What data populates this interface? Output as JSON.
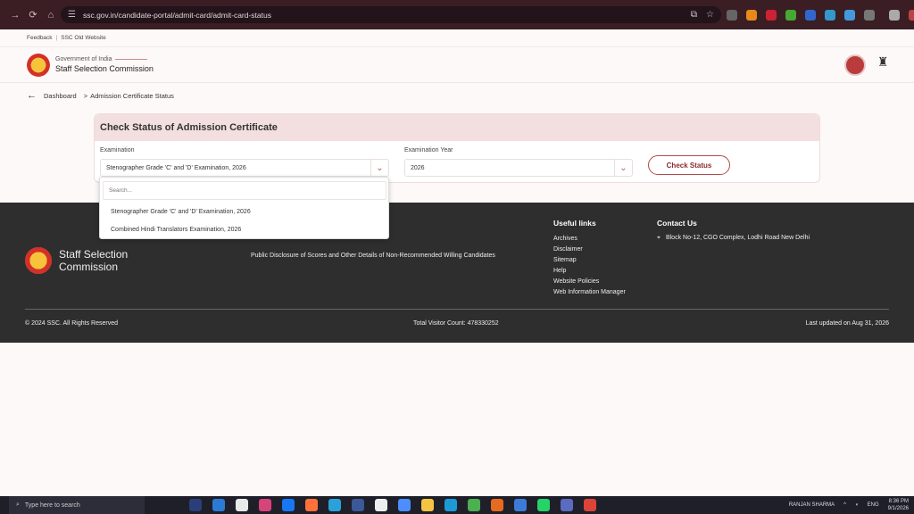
{
  "browser": {
    "url": "ssc.gov.in/candidate-portal/admit-card/admit-card-status"
  },
  "topbar": {
    "feedback": "Feedback",
    "old_site": "SSC Old Website"
  },
  "header": {
    "gov": "Government of India",
    "org": "Staff Selection Commission"
  },
  "breadcrumb": {
    "dashboard": "Dashboard",
    "separator": ">",
    "current": "Admission Certificate Status"
  },
  "form": {
    "title": "Check Status of Admission Certificate",
    "exam_label": "Examination",
    "exam_value": "Stenographer Grade 'C' and 'D' Examination, 2026",
    "year_label": "Examination Year",
    "year_value": "2026",
    "button": "Check Status"
  },
  "dropdown": {
    "search_placeholder": "Search...",
    "options": [
      "Stenographer Grade 'C' and 'D' Examination, 2026",
      "Combined Hindi Translators Examination, 2026"
    ]
  },
  "footer": {
    "org_line1": "Staff Selection",
    "org_line2": "Commission",
    "public_disclosure": "Public Disclosure of Scores and Other Details of Non-Recommended Willing Candidates",
    "useful_title": "Useful links",
    "useful_links": [
      "Archives",
      "Disclaimer",
      "Sitemap",
      "Help",
      "Website Policies",
      "Web Information Manager"
    ],
    "contact_title": "Contact Us",
    "address": "Block No-12, CGO Complex, Lodhi Road New Delhi",
    "copyright": "© 2024 SSC. All Rights Reserved",
    "visitor": "Total Visitor Count: 478330252",
    "updated": "Last updated on Aug 31, 2026"
  },
  "taskbar": {
    "search": "Type here to search",
    "user": "RANJAN SHARMA",
    "lang": "ENG",
    "time": "8:36 PM",
    "date": "9/1/2026"
  }
}
